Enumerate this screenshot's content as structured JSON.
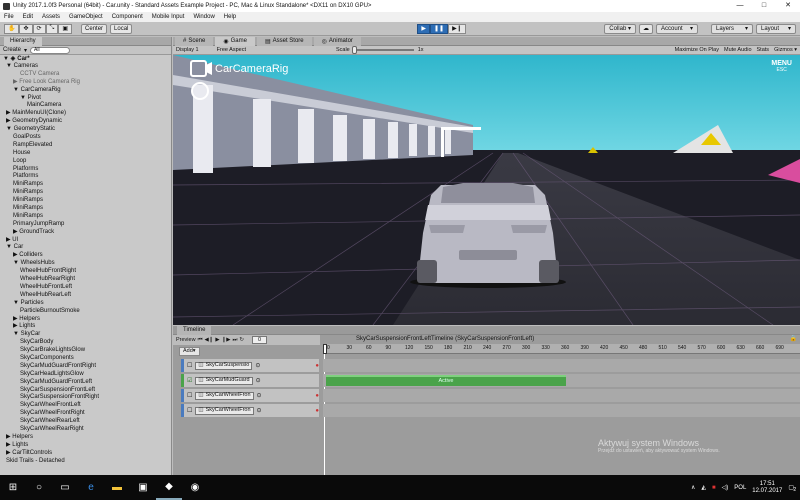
{
  "window": {
    "title": "Unity 2017.1.0f3 Personal (64bit) - Car.unity - Standard Assets Example Project - PC, Mac & Linux Standalone* <DX11 on DX10 GPU>",
    "min": "—",
    "max": "□",
    "close": "✕"
  },
  "menu": [
    "File",
    "Edit",
    "Assets",
    "GameObject",
    "Component",
    "Mobile Input",
    "Window",
    "Help"
  ],
  "toolbar": {
    "center": "Center",
    "local": "Local",
    "collab": "Collab ▾",
    "account": "Account",
    "layers": "Layers",
    "layout": "Layout"
  },
  "hierarchy": {
    "tab": "Hierarchy",
    "create": "Create",
    "search": "All",
    "scene": "Car*",
    "rows": [
      {
        "t": "▼ Cameras",
        "d": 0
      },
      {
        "t": "CCTV Camera",
        "d": 2,
        "dim": true
      },
      {
        "t": "▶ Free Look Camera Rig",
        "d": 1,
        "dim": true
      },
      {
        "t": "▼ CarCameraRig",
        "d": 1
      },
      {
        "t": "▼ Pivot",
        "d": 2
      },
      {
        "t": "MainCamera",
        "d": 3
      },
      {
        "t": "▶ MainMenuUI(Clone)",
        "d": 0
      },
      {
        "t": "▶ GeometryDynamic",
        "d": 0
      },
      {
        "t": "▼ GeometryStatic",
        "d": 0
      },
      {
        "t": "GoalPosts",
        "d": 1
      },
      {
        "t": "RampElevated",
        "d": 1
      },
      {
        "t": "House",
        "d": 1
      },
      {
        "t": "Loop",
        "d": 1
      },
      {
        "t": "Platforms",
        "d": 1
      },
      {
        "t": "Platforms",
        "d": 1
      },
      {
        "t": "MiniRamps",
        "d": 1
      },
      {
        "t": "MiniRamps",
        "d": 1
      },
      {
        "t": "MiniRamps",
        "d": 1
      },
      {
        "t": "MiniRamps",
        "d": 1
      },
      {
        "t": "MiniRamps",
        "d": 1
      },
      {
        "t": "PrimaryJumpRamp",
        "d": 1
      },
      {
        "t": "▶ GroundTrack",
        "d": 1
      },
      {
        "t": "▶ UI",
        "d": 0
      },
      {
        "t": "▼ Car",
        "d": 0
      },
      {
        "t": "▶ Colliders",
        "d": 1
      },
      {
        "t": "▼ WheelsHubs",
        "d": 1
      },
      {
        "t": "WheelHubFrontRight",
        "d": 2
      },
      {
        "t": "WheelHubRearRight",
        "d": 2
      },
      {
        "t": "WheelHubFrontLeft",
        "d": 2
      },
      {
        "t": "WheelHubRearLeft",
        "d": 2
      },
      {
        "t": "▼ Particles",
        "d": 1
      },
      {
        "t": "ParticleBurnoutSmoke",
        "d": 2
      },
      {
        "t": "▶ Helpers",
        "d": 1
      },
      {
        "t": "▶ Lights",
        "d": 1
      },
      {
        "t": "▼ SkyCar",
        "d": 1
      },
      {
        "t": "SkyCarBody",
        "d": 2
      },
      {
        "t": "SkyCarBrakeLightsGlow",
        "d": 2
      },
      {
        "t": "SkyCarComponents",
        "d": 2
      },
      {
        "t": "SkyCarMudGuardFrontRight",
        "d": 2
      },
      {
        "t": "SkyCarHeadLightsGlow",
        "d": 2
      },
      {
        "t": "SkyCarMudGuardFrontLeft",
        "d": 2
      },
      {
        "t": "SkyCarSuspensionFrontLeft",
        "d": 2
      },
      {
        "t": "SkyCarSuspensionFrontRight",
        "d": 2
      },
      {
        "t": "SkyCarWheelFrontLeft",
        "d": 2
      },
      {
        "t": "SkyCarWheelFrontRight",
        "d": 2
      },
      {
        "t": "SkyCarWheelRearLeft",
        "d": 2
      },
      {
        "t": "SkyCarWheelRearRight",
        "d": 2
      },
      {
        "t": "▶ Helpers",
        "d": 0
      },
      {
        "t": "▶ Lights",
        "d": 0
      },
      {
        "t": "▶ CarTiltControls",
        "d": 0
      },
      {
        "t": "Skid Trails - Detached",
        "d": 0
      }
    ]
  },
  "tabs": {
    "scene": "Scene",
    "game": "Game",
    "store": "Asset Store",
    "animator": "Animator"
  },
  "gametoolbar": {
    "display": "Display 1",
    "aspect": "Free Aspect",
    "scale": "Scale",
    "scale_val": "1x",
    "maximize": "Maximize On Play",
    "mute": "Mute Audio",
    "stats": "Stats",
    "gizmos": "Gizmos ▾"
  },
  "game": {
    "camera_label": "CarCameraRig",
    "menu": "MENU",
    "esc": "ESC"
  },
  "timeline": {
    "tab": "Timeline",
    "preview": "Preview",
    "add": "Add▾",
    "frame": "0",
    "asset": "SkyCarSuspensionFrontLeftTimeline (SkyCarSuspensionFrontLeft)",
    "ticks": [
      "0",
      "30",
      "60",
      "90",
      "120",
      "150",
      "180",
      "210",
      "240",
      "270",
      "300",
      "330",
      "360",
      "390",
      "420",
      "450",
      "480",
      "510",
      "540",
      "570",
      "600",
      "630",
      "660",
      "690"
    ],
    "tracks": [
      "SkyCarSuspensio",
      "SkyCarMudGuard",
      "SkyCarWheelFron",
      "SkyCarWheelFron"
    ],
    "clip": "Active",
    "watermark_title": "Aktywuj system Windows",
    "watermark_sub": "Przejdź do ustawień, aby aktywować system Windows."
  },
  "taskbar": {
    "lang": "POL",
    "time": "17:51",
    "date": "12.07.2017",
    "notif": "2"
  },
  "colors": {
    "accent": "#3a72c4",
    "sky": "#3ec2d6",
    "track_green": "#4aa34a"
  }
}
